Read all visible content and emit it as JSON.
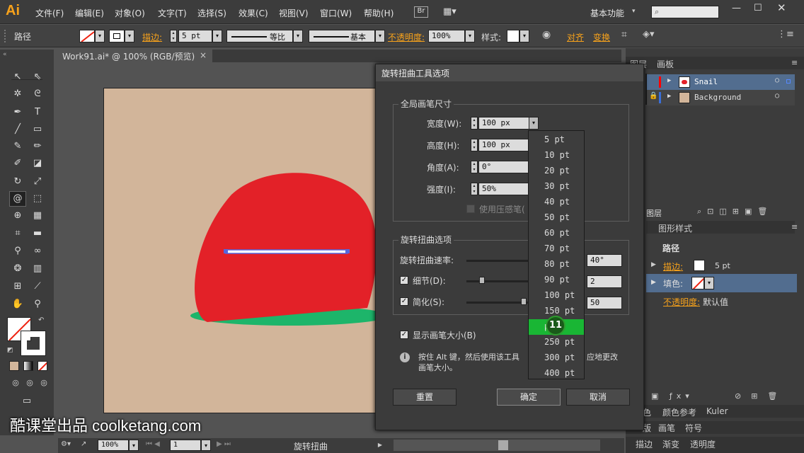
{
  "app": {
    "logo": "Ai",
    "workspace": "基本功能"
  },
  "menu": [
    "文件(F)",
    "编辑(E)",
    "对象(O)",
    "文字(T)",
    "选择(S)",
    "效果(C)",
    "视图(V)",
    "窗口(W)",
    "帮助(H)"
  ],
  "menu_extra": {
    "br": "Br"
  },
  "control": {
    "object_type": "路径",
    "stroke_label": "描边:",
    "stroke_value": "5 pt",
    "profile_label": "等比",
    "brush_label": "基本",
    "opacity_label": "不透明度:",
    "opacity_value": "100%",
    "style_label": "样式:",
    "align_label": "对齐",
    "transform_label": "变换"
  },
  "document": {
    "tab_title": "Work91.ai* @ 100% (RGB/预览)",
    "close": "×"
  },
  "status": {
    "zoom": "100%",
    "page": "1",
    "tool_name": "旋转扭曲"
  },
  "panels": {
    "tabs_top": [
      "图层",
      "画板"
    ],
    "layers": [
      {
        "name": "Snail"
      },
      {
        "name": "Background"
      }
    ],
    "layers_label": "图层",
    "graphic_styles_tab": "图形样式",
    "appearance": {
      "title": "路径",
      "stroke_label": "描边:",
      "stroke_value": "5 pt",
      "fill_label": "填色:",
      "opacity_label": "不透明度:",
      "opacity_value": "默认值"
    },
    "tabs_mid": [
      "色",
      "颜色参考",
      "Kuler"
    ],
    "tabs_mid2": [
      "版",
      "画笔",
      "符号"
    ],
    "tabs_bottom": [
      "描边",
      "渐变",
      "透明度"
    ]
  },
  "dialog": {
    "title": "旋转扭曲工具选项",
    "global_group": "全局画笔尺寸",
    "width_label": "宽度(W):",
    "width_value": "100 px",
    "height_label": "高度(H):",
    "height_value": "100 px",
    "angle_label": "角度(A):",
    "angle_value": "0°",
    "intensity_label": "强度(I):",
    "intensity_value": "50%",
    "pressure_label": "使用压感笔(",
    "options_group": "旋转扭曲选项",
    "rate_label": "旋转扭曲速率:",
    "rate_value": "40°",
    "detail_label": "细节(D):",
    "detail_value": "2",
    "simplify_label": "简化(S):",
    "simplify_value": "50",
    "show_size_label": "显示画笔大小(B)",
    "info_line1": "按住 Alt 键，然后使用该工具",
    "info_line1b": "应地更改",
    "info_line2": "画笔大小。",
    "reset": "重置",
    "ok": "确定",
    "cancel": "取消",
    "check": "✓"
  },
  "dropdown": {
    "options": [
      "5 pt",
      "10 pt",
      "20 pt",
      "30 pt",
      "40 pt",
      "50 pt",
      "60 pt",
      "70 pt",
      "80 pt",
      "90 pt",
      "100 pt",
      "150 pt",
      "pt",
      "250 pt",
      "300 pt",
      "400 pt"
    ],
    "selected_index": 12
  },
  "step_badge": "11",
  "watermark": "酷课堂出品 coolketang.com",
  "colors": {
    "accent": "#f7a21b",
    "selected": "#19b634",
    "snail_red": "#e32128",
    "snail_green": "#1db56a",
    "artboard": "#d2b59a"
  }
}
